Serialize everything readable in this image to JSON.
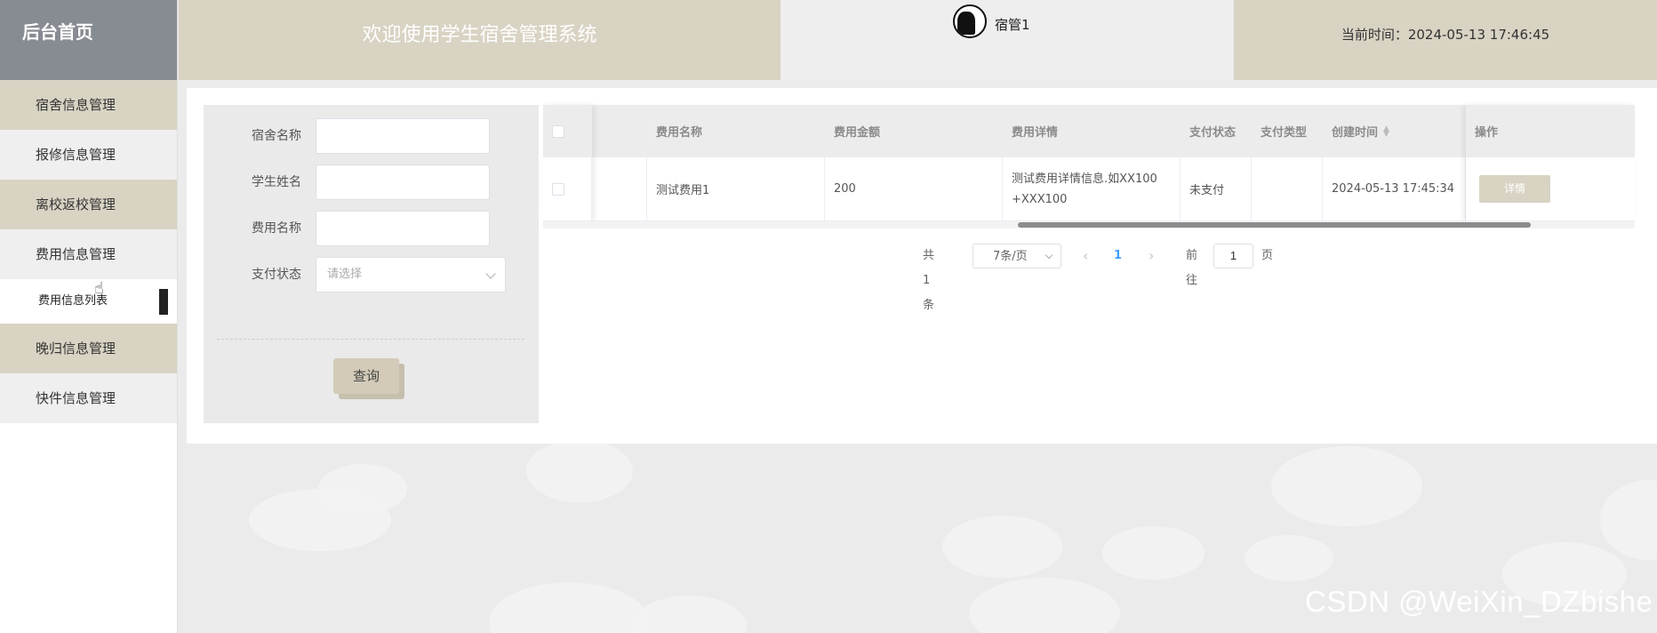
{
  "sidebar": {
    "brand": "后台首页",
    "items": [
      {
        "label": "宿舍信息管理"
      },
      {
        "label": "报修信息管理"
      },
      {
        "label": "离校返校管理"
      },
      {
        "label": "费用信息管理"
      },
      {
        "label": "费用信息列表"
      },
      {
        "label": "晚归信息管理"
      },
      {
        "label": "快件信息管理"
      }
    ]
  },
  "header": {
    "title": "欢迎使用学生宿舍管理系统",
    "username": "宿管1",
    "time": "当前时间：2024-05-13 17:46:45"
  },
  "search": {
    "fields": [
      {
        "label": "宿舍名称",
        "value": ""
      },
      {
        "label": "学生姓名",
        "value": ""
      },
      {
        "label": "费用名称",
        "value": ""
      },
      {
        "label": "支付状态",
        "placeholder": "请选择"
      }
    ],
    "button": "查询"
  },
  "table": {
    "columns": [
      "费用名称",
      "费用金额",
      "费用详情",
      "支付状态",
      "支付类型",
      "创建时间",
      "操作"
    ],
    "rows": [
      {
        "name": "测试费用1",
        "amount": "200",
        "detail_line1": "测试费用详情信息.如XX100",
        "detail_line2": "+XXX100",
        "status": "未支付",
        "pay_type": "",
        "created": "2024-05-13 17:45:34",
        "action": "详情"
      }
    ]
  },
  "pager": {
    "total": "共 1 条",
    "page_size": "7条/页",
    "current": "1",
    "goto_label": "前往",
    "goto_value": "1",
    "page_suffix": "页"
  },
  "watermark": "CSDN @WeiXin_DZbishe",
  "colors": {
    "accent": "#d8d3c3",
    "brand_bg": "#878c92",
    "link": "#409eff"
  }
}
